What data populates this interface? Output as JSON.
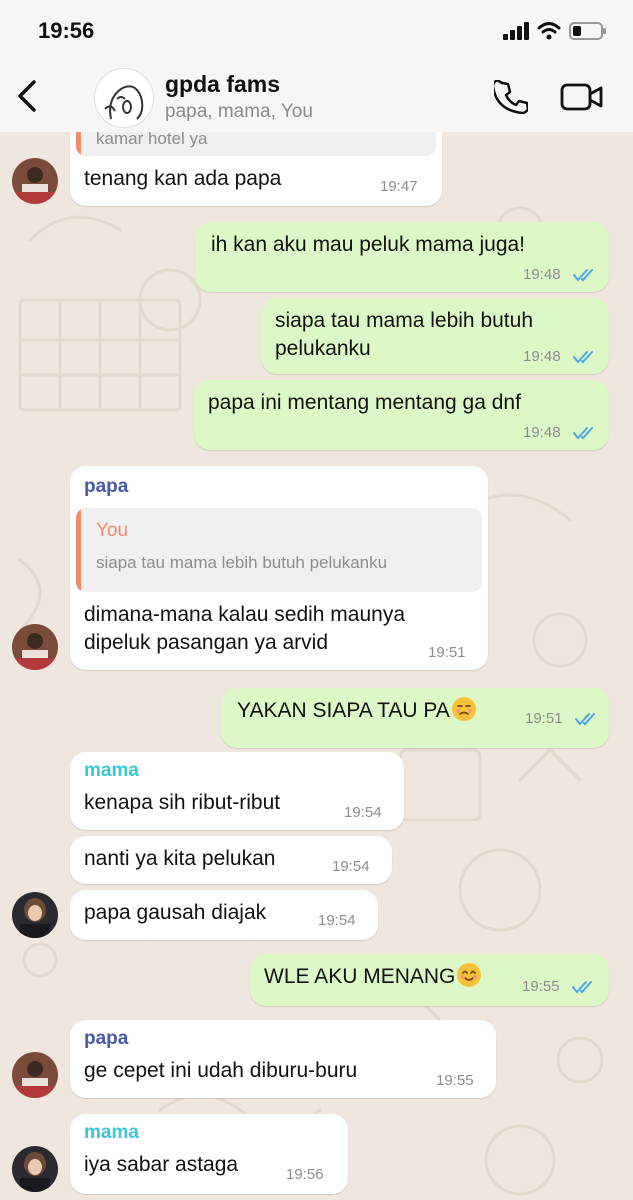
{
  "status_bar": {
    "time": "19:56"
  },
  "header": {
    "group_name": "gpda fams",
    "members": "papa, mama, You"
  },
  "colors": {
    "incoming_bubble": "#ffffff",
    "outgoing_bubble": "#dcf8c6",
    "sender_papa": "#4a5aa8",
    "sender_mama": "#3cc6d6",
    "quote_you": "#f28a6a",
    "read_ticks": "#4fa3e8"
  },
  "messages": [
    {
      "dir": "in",
      "text": "kamar hotel ya",
      "partial_quote": true
    },
    {
      "dir": "in",
      "text": "tenang kan ada papa",
      "time": "19:47"
    },
    {
      "dir": "out",
      "text": "ih kan aku mau peluk mama juga!",
      "time": "19:48",
      "status": "read"
    },
    {
      "dir": "out",
      "lines": [
        "siapa tau mama lebih butuh",
        "pelukanku"
      ],
      "time": "19:48",
      "status": "read"
    },
    {
      "dir": "out",
      "text": "papa ini mentang mentang ga dnf",
      "time": "19:48",
      "status": "read"
    },
    {
      "dir": "in",
      "sender": "papa",
      "quote": {
        "author": "You",
        "text": "siapa tau mama lebih butuh pelukanku"
      },
      "lines": [
        "dimana-mana kalau sedih maunya",
        "dipeluk pasangan ya arvid"
      ],
      "time": "19:51"
    },
    {
      "dir": "out",
      "text": "YAKAN SIAPA TAU PA",
      "emoji": "unamused-face",
      "time": "19:51",
      "status": "read"
    },
    {
      "dir": "in",
      "sender": "mama",
      "text": "kenapa sih ribut-ribut",
      "time": "19:54"
    },
    {
      "dir": "in",
      "text": "nanti ya kita pelukan",
      "time": "19:54"
    },
    {
      "dir": "in",
      "text": "papa gausah diajak",
      "time": "19:54"
    },
    {
      "dir": "out",
      "text": "WLE AKU MENANG",
      "emoji": "smiling-face",
      "time": "19:55",
      "status": "read"
    },
    {
      "dir": "in",
      "sender": "papa",
      "text": "ge cepet ini udah diburu-buru",
      "time": "19:55"
    },
    {
      "dir": "in",
      "sender": "mama",
      "text": "iya sabar astaga",
      "time": "19:56"
    }
  ]
}
